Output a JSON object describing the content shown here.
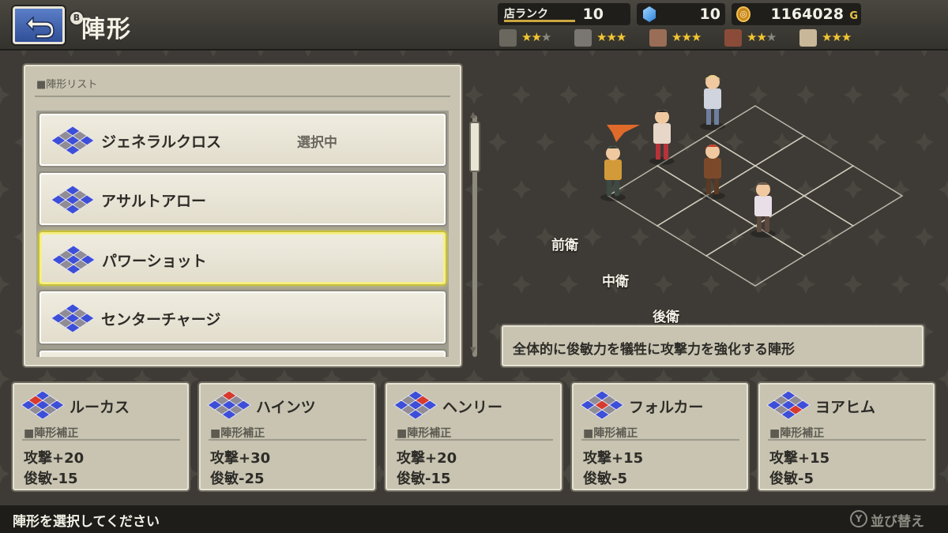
{
  "header": {
    "title": "陣形",
    "back_badge": "B",
    "shop_rank_label": "店ランク",
    "shop_rank_value": "10",
    "gem_value": "10",
    "gold_value": "1164028",
    "gold_suffix": "G",
    "skills": [
      {
        "icon": "pickaxe-icon",
        "stars": 2,
        "max": 3
      },
      {
        "icon": "cooking-pot-icon",
        "stars": 3,
        "max": 3
      },
      {
        "icon": "weaving-icon",
        "stars": 3,
        "max": 3
      },
      {
        "icon": "shelf-icon",
        "stars": 2,
        "max": 3
      },
      {
        "icon": "scroll-icon",
        "stars": 3,
        "max": 3
      }
    ]
  },
  "formation_list": {
    "header": "■陣形リスト",
    "items": [
      {
        "name": "ジェネラルクロス",
        "badge": "選択中",
        "selected": false
      },
      {
        "name": "アサルトアロー",
        "badge": "",
        "selected": false
      },
      {
        "name": "パワーショット",
        "badge": "",
        "selected": true
      },
      {
        "name": "センターチャージ",
        "badge": "",
        "selected": false
      }
    ]
  },
  "preview": {
    "rows": [
      "前衛",
      "中衛",
      "後衛"
    ]
  },
  "description": "全体的に俊敏力を犠牲に攻撃力を強化する陣形",
  "members": [
    {
      "name": "ルーカス",
      "tag": "■陣形補正",
      "atk": "攻撃+20",
      "agi": "俊敏-15"
    },
    {
      "name": "ハインツ",
      "tag": "■陣形補正",
      "atk": "攻撃+30",
      "agi": "俊敏-25"
    },
    {
      "name": "ヘンリー",
      "tag": "■陣形補正",
      "atk": "攻撃+20",
      "agi": "俊敏-15"
    },
    {
      "name": "フォルカー",
      "tag": "■陣形補正",
      "atk": "攻撃+15",
      "agi": "俊敏-5"
    },
    {
      "name": "ヨアヒム",
      "tag": "■陣形補正",
      "atk": "攻撃+15",
      "agi": "俊敏-5"
    }
  ],
  "footer": {
    "hint": "陣形を選択してください",
    "y_badge": "Y",
    "sort_label": "並び替え"
  },
  "colors": {
    "accent_blue": "#3d4fd8",
    "marker_red": "#d83a2e",
    "panel": "#c8c4b1",
    "selection_glow": "#f5ee6a",
    "star": "#f0c632"
  }
}
